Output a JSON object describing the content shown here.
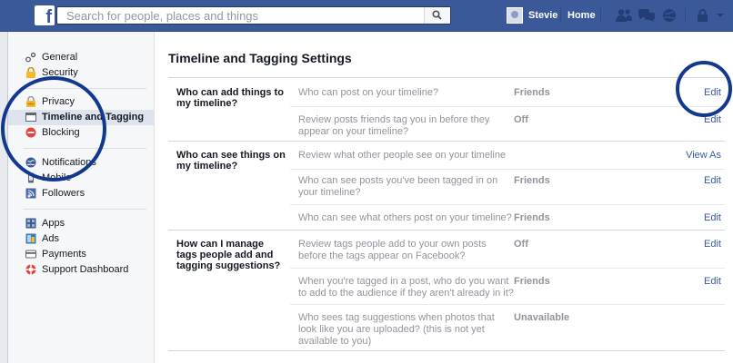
{
  "topbar": {
    "logo": "f",
    "search_placeholder": "Search for people, places and things",
    "user_name": "Stevie",
    "home_label": "Home",
    "icons": [
      "friend-requests-icon",
      "messages-icon",
      "notifications-icon",
      "privacy-shortcuts-icon",
      "account-menu-icon"
    ],
    "colors": {
      "bar": "#3b5998",
      "link": "#3b5998",
      "ring": "#12398f"
    }
  },
  "sidebar": {
    "groups": [
      [
        {
          "label": "General",
          "icon": "gear-icon"
        },
        {
          "label": "Security",
          "icon": "lock-icon"
        }
      ],
      [
        {
          "label": "Privacy",
          "icon": "privacy-icon"
        },
        {
          "label": "Timeline and Tagging",
          "icon": "timeline-icon",
          "active": true
        },
        {
          "label": "Blocking",
          "icon": "blocking-icon"
        }
      ],
      [
        {
          "label": "Notifications",
          "icon": "notifications-icon"
        },
        {
          "label": "Mobile",
          "icon": "mobile-icon"
        },
        {
          "label": "Followers",
          "icon": "followers-icon"
        }
      ],
      [
        {
          "label": "Apps",
          "icon": "apps-icon"
        },
        {
          "label": "Ads",
          "icon": "ads-icon"
        },
        {
          "label": "Payments",
          "icon": "payments-icon"
        },
        {
          "label": "Support Dashboard",
          "icon": "support-icon"
        }
      ]
    ]
  },
  "main": {
    "title": "Timeline and Tagging Settings",
    "sections": [
      {
        "label": "Who can add things to my timeline?",
        "rows": [
          {
            "question": "Who can post on your timeline?",
            "value": "Friends",
            "action": "Edit"
          },
          {
            "question": "Review posts friends tag you in before they appear on your timeline?",
            "value": "Off",
            "action": "Edit"
          }
        ]
      },
      {
        "label": "Who can see things on my timeline?",
        "rows": [
          {
            "question": "Review what other people see on your timeline",
            "value": "",
            "action": "View As"
          },
          {
            "question": "Who can see posts you've been tagged in on your timeline?",
            "value": "Friends",
            "action": "Edit"
          },
          {
            "question": "Who can see what others post on your timeline?",
            "value": "Friends",
            "action": "Edit"
          }
        ]
      },
      {
        "label": "How can I manage tags people add and tagging suggestions?",
        "rows": [
          {
            "question": "Review tags people add to your own posts before the tags appear on Facebook?",
            "value": "Off",
            "action": "Edit"
          },
          {
            "question": "When you're tagged in a post, who do you want to add to the audience if they aren't already in it?",
            "value": "Friends",
            "action": "Edit"
          },
          {
            "question": "Who sees tag suggestions when photos that look like you are uploaded? (this is not yet available to you)",
            "value": "Unavailable",
            "action": ""
          }
        ]
      }
    ]
  }
}
